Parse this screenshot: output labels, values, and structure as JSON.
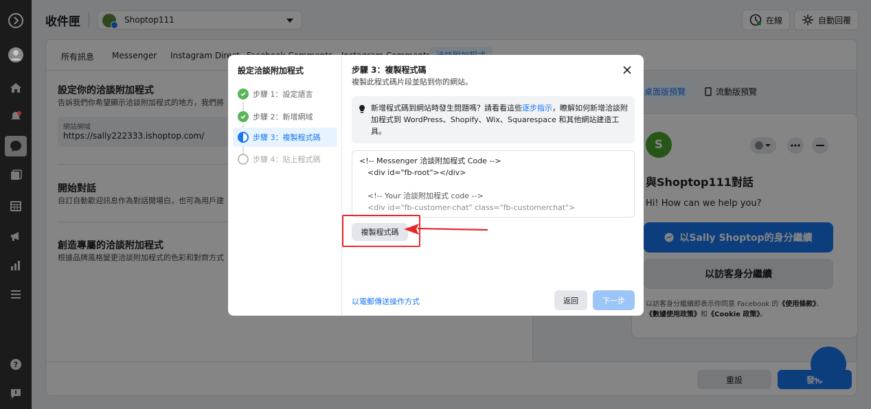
{
  "app": {
    "title": "收件匣",
    "page_selector": {
      "value": "Shoptop111"
    },
    "status_button": "在線",
    "auto_reply_button": "自動回覆"
  },
  "tabs": [
    "所有訊息",
    "Messenger",
    "Instagram Direct",
    "Facebook Comments",
    "Instagram Comments",
    "洽談附加程式"
  ],
  "settings": {
    "section1": {
      "title": "設定你的洽談附加程式",
      "desc": "告訴我們你希望顯示洽談附加程式的地方，我們將"
    },
    "url_field": {
      "label": "網站網域",
      "value": "https://sally222333.ishoptop.com/"
    },
    "section2": {
      "title": "開始對話",
      "desc": "自訂自動歡迎訊息作為對話開場白，也可為用戶建"
    },
    "section3": {
      "title": "創造專屬的洽談附加程式",
      "desc": "根據品牌風格變更洽談附加程式的色彩和對齊方式"
    }
  },
  "preview": {
    "desktop_tab": "桌面版預覽",
    "mobile_tab": "流動版預覽",
    "avatar_letter": "S",
    "chat_title": "與Shoptop111對話",
    "greeting": "Hi! How can we help you?",
    "continue_as_user": "以Sally Shoptop的身分繼續",
    "continue_as_guest": "以訪客身分繼續",
    "terms_prefix": "以訪客身分繼續即表示你同意 Facebook 的",
    "terms_link1": "《使用條款》",
    "terms_sep": "、",
    "terms_link2": "《數據使用政策》",
    "terms_and": "和",
    "terms_link3": "《Cookie 政策》",
    "terms_end": "。"
  },
  "footer": {
    "reset": "重設",
    "publish": "發佈"
  },
  "modal": {
    "steps_title": "設定洽談附加程式",
    "steps": [
      {
        "label": "步驟 1：設定語言",
        "state": "done"
      },
      {
        "label": "步驟 2：新增網域",
        "state": "done"
      },
      {
        "label": "步驟 3：複製程式碼",
        "state": "current"
      },
      {
        "label": "步驟 4：貼上程式碼",
        "state": "todo"
      }
    ],
    "title": "步驟 3：複製程式碼",
    "subtitle": "複製此程式碼片段並貼到你的網站。",
    "tip_before": "新增程式碼到網站時發生問題嗎？請看看這些",
    "tip_link": "逐步指示",
    "tip_after": "，瞭解如何新增洽談附加程式到 WordPress、Shopify、Wix、Squarespace 和其他網站建造工具。",
    "code_lines": [
      "<!-- Messenger 洽談附加程式 Code -->",
      "<div id=\"fb-root\"></div>",
      "",
      "<!-- Your 洽談附加程式 code -->",
      "<div id=\"fb-customer-chat\" class=\"fb-customerchat\">"
    ],
    "copy_button": "複製程式碼",
    "email_link": "以電郵傳送操作方式",
    "back_button": "返回",
    "next_button": "下一步"
  },
  "colors": {
    "accent": "#1877f2",
    "highlight": "#e32a2a",
    "success": "#5ab55a"
  }
}
